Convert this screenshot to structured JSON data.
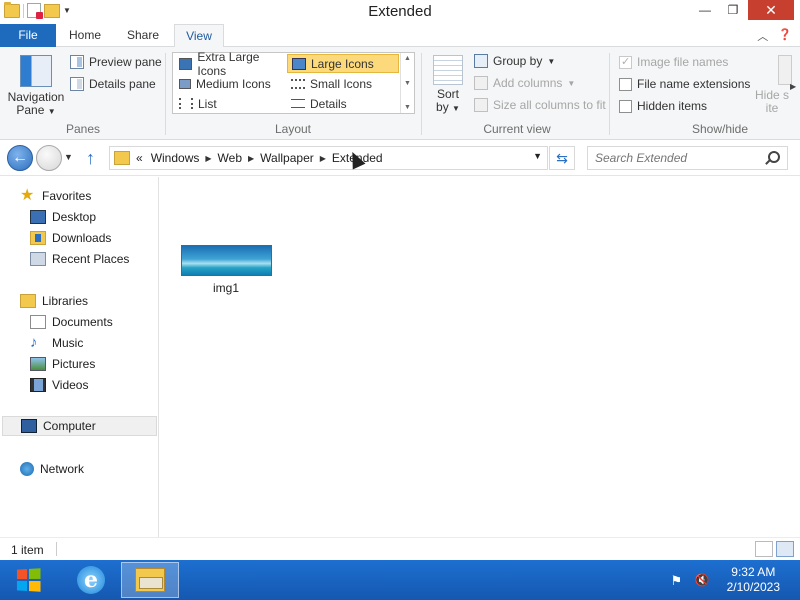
{
  "window": {
    "title": "Extended"
  },
  "ribbon_tabs": {
    "file": "File",
    "home": "Home",
    "share": "Share",
    "view": "View"
  },
  "panes": {
    "navigation_pane": "Navigation",
    "navigation_pane_line2": "Pane",
    "preview_pane": "Preview pane",
    "details_pane": "Details pane",
    "group_label": "Panes"
  },
  "layout": {
    "extra_large_icons": "Extra Large Icons",
    "large_icons": "Large Icons",
    "medium_icons": "Medium Icons",
    "small_icons": "Small Icons",
    "list": "List",
    "details": "Details",
    "group_label": "Layout",
    "selected": "Large Icons"
  },
  "current_view": {
    "sort_by": "Sort",
    "sort_by_line2": "by",
    "group_by": "Group by",
    "add_columns": "Add columns",
    "size_all_columns": "Size all columns to fit",
    "group_label": "Current view"
  },
  "show_hide": {
    "image_file_names": "Image file names",
    "file_name_extensions": "File name extensions",
    "hidden_items": "Hidden items",
    "hide_selected": "Hide s",
    "hide_selected_line2": "ite",
    "group_label": "Show/hide"
  },
  "address_bar": {
    "overflow": "«",
    "crumbs": [
      "Windows",
      "Web",
      "Wallpaper",
      "Extended"
    ]
  },
  "search": {
    "placeholder": "Search Extended"
  },
  "nav_pane": {
    "favorites": "Favorites",
    "desktop": "Desktop",
    "downloads": "Downloads",
    "recent_places": "Recent Places",
    "libraries": "Libraries",
    "documents": "Documents",
    "music": "Music",
    "pictures": "Pictures",
    "videos": "Videos",
    "computer": "Computer",
    "network": "Network"
  },
  "files": [
    {
      "name": "img1"
    }
  ],
  "status": {
    "item_count": "1 item"
  },
  "taskbar": {
    "time": "9:32 AM",
    "date": "2/10/2023",
    "accent": "#1d6fd0"
  }
}
